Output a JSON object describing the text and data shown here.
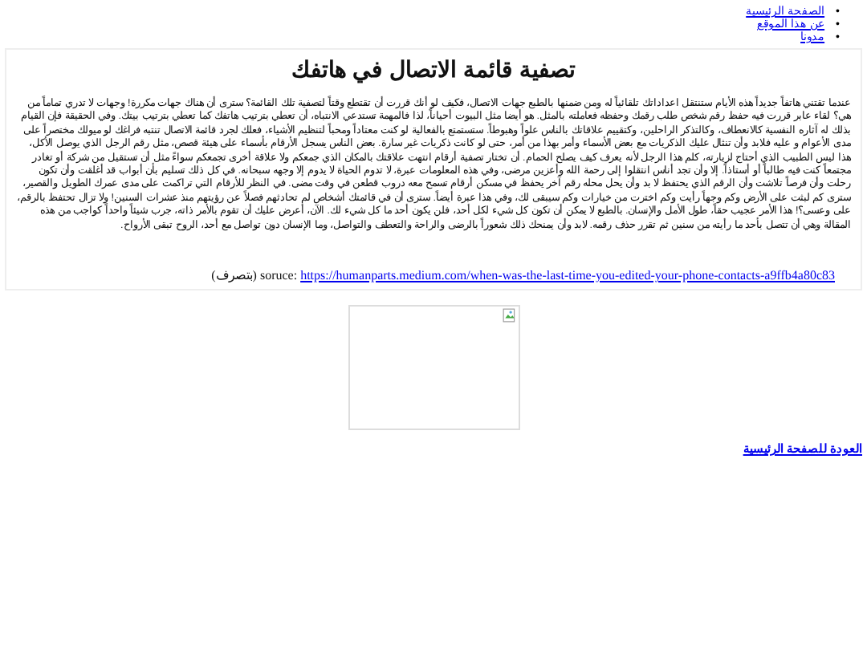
{
  "nav": [
    {
      "marker": "•",
      "label": "الصفحة الرئيسية"
    },
    {
      "marker": "•",
      "label": "عن هذا الموقع"
    },
    {
      "marker": "•",
      "label": "مدونا"
    }
  ],
  "article": {
    "title": "تصفية قائمة الاتصال في هاتفك",
    "body": "عندما تقتني هاتفاً جديداً هذه الأيام ستنتقل اعداداتك تلقائياً له ومن ضمنها بالطبع جهات الاتصال، فكيف لو أنك قررت أن تقتطع وقتاً لتصفية تلك القائمة؟ سترى أن هناك جهات مكررة! وجهات لا تدري تماماً من هي؟ لقاء عابر قررت فيه حفظ رقم شخص طلب رقمك وحفظه فعاملته بالمثل. هو أيضا مثل البيوت أحياناً، لذا فالمهمة تستدعي الانتباه، أن تعطي بترتيب هاتفك كما تعطي بترتيب بيتك. وفي الحقيقة فإن القيام بذلك له آثاره النفسية كالانعطاف، وكالتذكر الراحلين، وكتقييم علاقاتك بالناس علواً وهبوطاً. ستستمتع بالفعالية لو كنت معتاداً ومحباً لتنظيم الأشياء، فعلك لجرد قائمة الاتصال تنتبه فراغك لو ميولك مختصراً على مدى الأعوام و عليه فلابد وأن تنثال عليك الذكريات مع بعض الأسماء وأمر بهذا من أمر، حتى لو كانت ذكريات غير سارة. بعض الناس يسجل الأرقام بأسماء على هيئة قصص، مثل رقم الرجل الذي يوصل الأكل، هذا ليس الطبيب الذي أحتاج لزيارته، كلم هذا الرجل لأنه يعرف كيف يصلح الحمام. أن تختار تصفية أرقام انتهت علاقتك بالمكان الذي جمعكم ولا علاقة أخرى تجمعكم سواءً مثل أن تستقيل من شركة أو تغادر مجتمعاً كنت فيه طالباً أو أستاذاً. إلا وأن تجد أناس انتقلوا إلى رحمة الله وأعزين مرضى، وفي هذه المعلومات عبرة، لا تدوم الحياة لا يدوم إلا وجهه سبحانه. في كل ذلك تسليم بأن أبواب قد أغلقت وأن تكون رحلت وأن فرصاً تلاشت وأن الرقم الذي يحتفظ لا بد وأن يحل محله رقم آخر يحفظ في مسكن أرقام تسمح معه دروب قطعن في وقت مضى. في النظر للأرقام التي تراكمت على مدى عمرك الطويل والقصير، سترى كم لبثت على الأرض وكم وجهاً رأيت وكم اخترت من خيارات وكم سيبقى لك، وفي هذا عبرة أيضاً. سترى أن في قائمتك أشخاص لم تحادثهم فصلاً عن رؤيتهم منذ عشرات السنين! ولا تزال تحتفظ بالرقم، على وعسى؟! هذا الأمر عجيب حقاً، طول الأمل والإنسان. بالطبع لا يمكن أن تكون كل شيء لكل أحد، فلن يكون أحد ما كل شيء لك. الآن، أعرض عليك أن تقوم بالأمر ذاته، جرب شيئاً واحداً كواجب من هذه المقالة وهي أن تتصل بأحد ما رأيته من سنين ثم تقرر حذف رقمه. لابد وأن يمنحك ذلك شعوراً بالرضى والراحة والتعطف والتواصل، وما الإنسان دون تواصل مع أحد، الروح تبقى الأرواح.",
    "source_note": "(بتصرف)",
    "source_label": "soruce:",
    "source_url": "https://humanparts.medium.com/when-was-the-last-time-you-edited-your-phone-contacts-a9ffb4a80c83"
  },
  "back_link": "العودة للصفحة الرئيسية"
}
